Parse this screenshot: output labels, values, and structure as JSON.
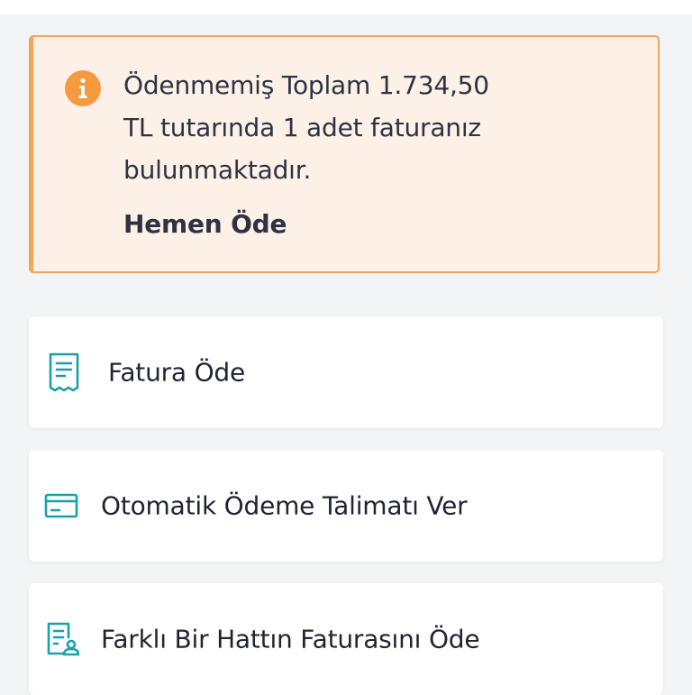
{
  "alert": {
    "icon": "info-icon",
    "accent_color": "#f5a45c",
    "background_color": "#fdf0e6",
    "message_lines": [
      "Ödenmemiş Toplam 1.734,50",
      "TL tutarında 1 adet faturanız",
      "bulunmaktadır."
    ],
    "action_label": "Hemen Öde"
  },
  "menu": {
    "icon_color": "#1ba0a8",
    "items": [
      {
        "icon": "receipt-icon",
        "label": "Fatura Öde"
      },
      {
        "icon": "credit-card-icon",
        "label": "Otomatik Ödeme Talimatı Ver"
      },
      {
        "icon": "document-user-icon",
        "label": "Farklı Bir Hattın Faturasını Öde"
      }
    ]
  }
}
